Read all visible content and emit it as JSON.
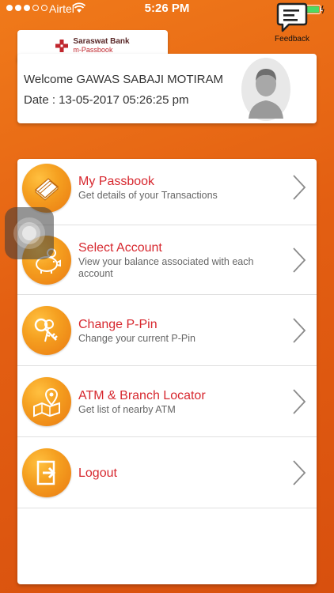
{
  "status_bar": {
    "carrier": "Airtel",
    "time": "5:26 PM"
  },
  "feedback": {
    "label": "Feedback"
  },
  "bank": {
    "name": "Saraswat Bank",
    "app": "m-Passbook"
  },
  "welcome": {
    "greeting": "Welcome GAWAS SABAJI MOTIRAM",
    "date": "Date : 13-05-2017 05:26:25 pm"
  },
  "menu": {
    "items": [
      {
        "title": "My Passbook",
        "subtitle": "Get details of your Transactions",
        "icon": "passbook-icon"
      },
      {
        "title": "Select Account",
        "subtitle": "View your balance associated with each account",
        "icon": "piggy-bank-icon"
      },
      {
        "title": "Change P-Pin",
        "subtitle": "Change your current P-Pin",
        "icon": "keys-icon"
      },
      {
        "title": "ATM & Branch Locator",
        "subtitle": "Get list of nearby ATM",
        "icon": "map-pin-icon"
      },
      {
        "title": "Logout",
        "subtitle": "",
        "icon": "logout-icon"
      }
    ]
  },
  "colors": {
    "background": "#e35f12",
    "accent_red": "#d7282f",
    "icon_orange": "#f5a020"
  }
}
